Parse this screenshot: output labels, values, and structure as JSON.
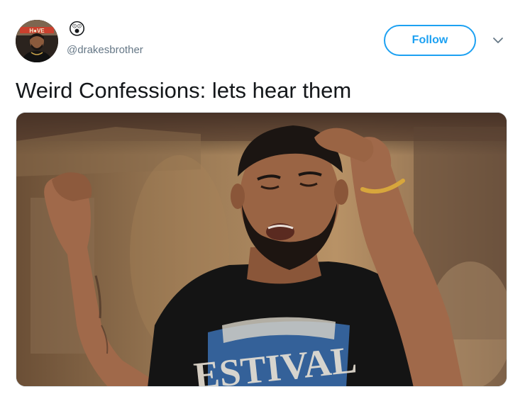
{
  "tweet": {
    "display_name_emoji": "😲",
    "handle": "@drakesbrother",
    "follow_label": "Follow",
    "text": "Weird Confessions: lets hear them",
    "avatar_icon": "user-avatar-photo",
    "media": {
      "description_icon": "photo-man-dancing",
      "shirt_print": "ESTIVAL"
    }
  },
  "colors": {
    "accent": "#1da1f2",
    "text": "#14171a",
    "muted": "#657786"
  }
}
